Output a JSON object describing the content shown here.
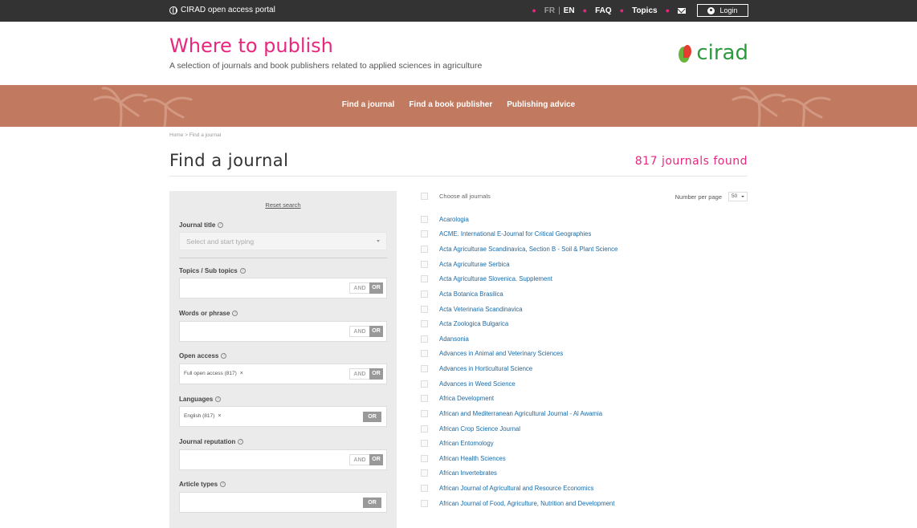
{
  "topbar": {
    "portal": "CIRAD open access portal",
    "lang_fr": "FR",
    "lang_sep": "|",
    "lang_en": "EN",
    "faq": "FAQ",
    "topics": "Topics",
    "login": "Login"
  },
  "header": {
    "title": "Where to publish",
    "subtitle": "A selection of journals and book publishers related to applied sciences in agriculture",
    "logo_text": "cirad"
  },
  "nav": {
    "items": [
      "Find a journal",
      "Find a book publisher",
      "Publishing advice"
    ]
  },
  "breadcrumb": "Home > Find a journal",
  "page": {
    "title": "Find a journal",
    "found": "817 journals found"
  },
  "filters": {
    "reset": "Reset search",
    "journal_title": {
      "label": "Journal title",
      "placeholder": "Select and start typing"
    },
    "topics": {
      "label": "Topics / Sub topics",
      "and": "AND",
      "or": "OR"
    },
    "words": {
      "label": "Words or phrase",
      "and": "AND",
      "or": "OR"
    },
    "open_access": {
      "label": "Open access",
      "chip": "Full open access (817)",
      "chip_remove": "×",
      "and": "AND",
      "or": "OR"
    },
    "languages": {
      "label": "Languages",
      "chip": "English (817)",
      "chip_remove": "×",
      "or": "OR"
    },
    "reputation": {
      "label": "Journal reputation",
      "and": "AND",
      "or": "OR"
    },
    "article_types": {
      "label": "Article types",
      "or": "OR"
    },
    "help_glyph": "?"
  },
  "results": {
    "choose_all": "Choose all journals",
    "per_page_label": "Number per page",
    "per_page_value": "50",
    "journals": [
      "Acarologia",
      "ACME. International E-Journal for Critical Geographies",
      "Acta Agriculturae Scandinavica, Section B - Soil & Plant Science",
      "Acta Agriculturae Serbica",
      "Acta Agriculturae Slovenica. Supplement",
      "Acta Botanica Brasilica",
      "Acta Veterinaria Scandinavica",
      "Acta Zoologica Bulgarica",
      "Adansonia",
      "Advances in Animal and Veterinary Sciences",
      "Advances in Horticultural Science",
      "Advances in Weed Science",
      "Africa Development",
      "African and Mediterranean Agricultural Journal - Al Awamia",
      "African Crop Science Journal",
      "African Entomology",
      "African Health Sciences",
      "African Invertebrates",
      "African Journal of Agricultural and Resource Economics",
      "African Journal of Food, Agriculture, Nutrition and Development"
    ]
  },
  "colors": {
    "accent": "#e8287f",
    "band": "#c17a5f",
    "link": "#1b6aa5",
    "topbar": "#333333"
  }
}
